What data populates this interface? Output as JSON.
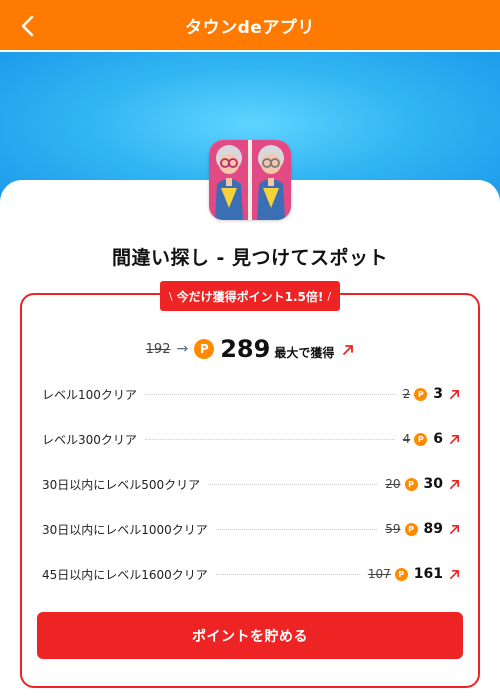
{
  "header": {
    "title": "タウンdeアプリ"
  },
  "app": {
    "title": "間違い探し - 見つけてスポット"
  },
  "promo": {
    "ribbon_text": "今だけ獲得ポイント1.5倍!",
    "slash_left": "\\",
    "slash_right": "/"
  },
  "summary": {
    "old_points": "192",
    "new_points": "289",
    "max_label": "最大で獲得",
    "coin_symbol": "P"
  },
  "tasks": [
    {
      "label": "レベル100クリア",
      "old": "2",
      "new": "3"
    },
    {
      "label": "レベル300クリア",
      "old": "4",
      "new": "6"
    },
    {
      "label": "30日以内にレベル500クリア",
      "old": "20",
      "new": "30"
    },
    {
      "label": "30日以内にレベル1000クリア",
      "old": "59",
      "new": "89"
    },
    {
      "label": "45日以内にレベル1600クリア",
      "old": "107",
      "new": "161"
    }
  ],
  "cta": {
    "label": "ポイントを貯める"
  },
  "colors": {
    "header": "#ff7a00",
    "accent_red": "#ee2424",
    "coin": "#ff8a00",
    "hero_blue": "#32b6f2"
  }
}
